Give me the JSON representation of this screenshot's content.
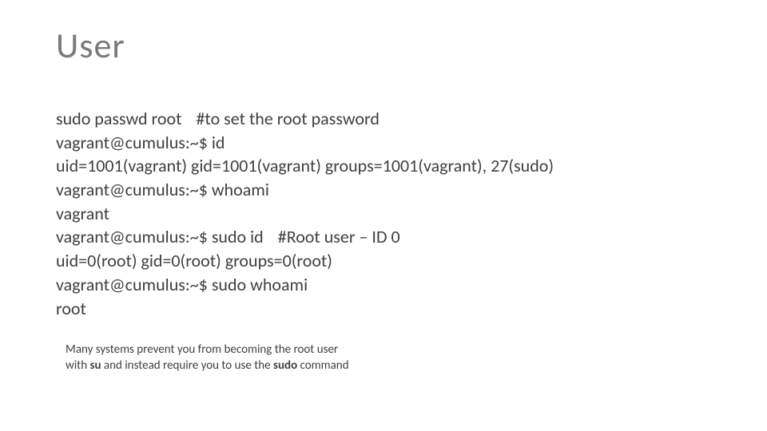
{
  "title": "User",
  "terminal": {
    "l1a": "sudo passwd root",
    "l1b": "#to set the root password",
    "l2": "vagrant@cumulus:~$ id",
    "l3": "uid=1001(vagrant) gid=1001(vagrant) groups=1001(vagrant), 27(sudo)",
    "l4": "vagrant@cumulus:~$ whoami",
    "l5": "vagrant",
    "l6a": "vagrant@cumulus:~$ sudo id",
    "l6b": "#Root user – ID 0",
    "l7": "uid=0(root) gid=0(root) groups=0(root)",
    "l8": "vagrant@cumulus:~$ sudo whoami",
    "l9": "root"
  },
  "footnote": {
    "line1_pre": "Many systems prevent you from becoming the root user",
    "line2_pre": "with ",
    "line2_b1": "su",
    "line2_mid": " and instead require you to use the ",
    "line2_b2": "sudo",
    "line2_post": " command"
  }
}
